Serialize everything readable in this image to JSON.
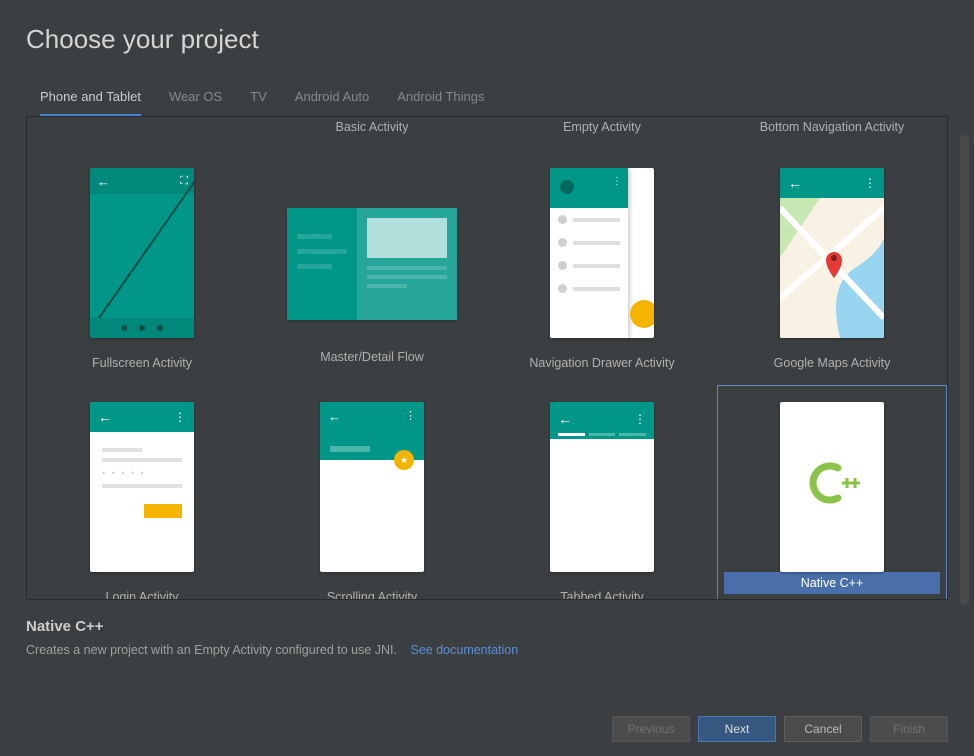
{
  "header": {
    "title": "Choose your project"
  },
  "tabs": [
    {
      "label": "Phone and Tablet",
      "active": true
    },
    {
      "label": "Wear OS"
    },
    {
      "label": "TV"
    },
    {
      "label": "Android Auto"
    },
    {
      "label": "Android Things"
    }
  ],
  "partial_row": [
    "Basic Activity",
    "Empty Activity",
    "Bottom Navigation Activity"
  ],
  "templates": {
    "row1": [
      "Fullscreen Activity",
      "Master/Detail Flow",
      "Navigation Drawer Activity",
      "Google Maps Activity"
    ],
    "row2": [
      "Login Activity",
      "Scrolling Activity",
      "Tabbed Activity",
      "Native C++"
    ]
  },
  "selected_template": "Native C++",
  "description": {
    "title": "Native C++",
    "text": "Creates a new project with an Empty Activity configured to use JNI.",
    "link": "See documentation"
  },
  "buttons": {
    "previous": "Previous",
    "next": "Next",
    "cancel": "Cancel",
    "finish": "Finish"
  }
}
